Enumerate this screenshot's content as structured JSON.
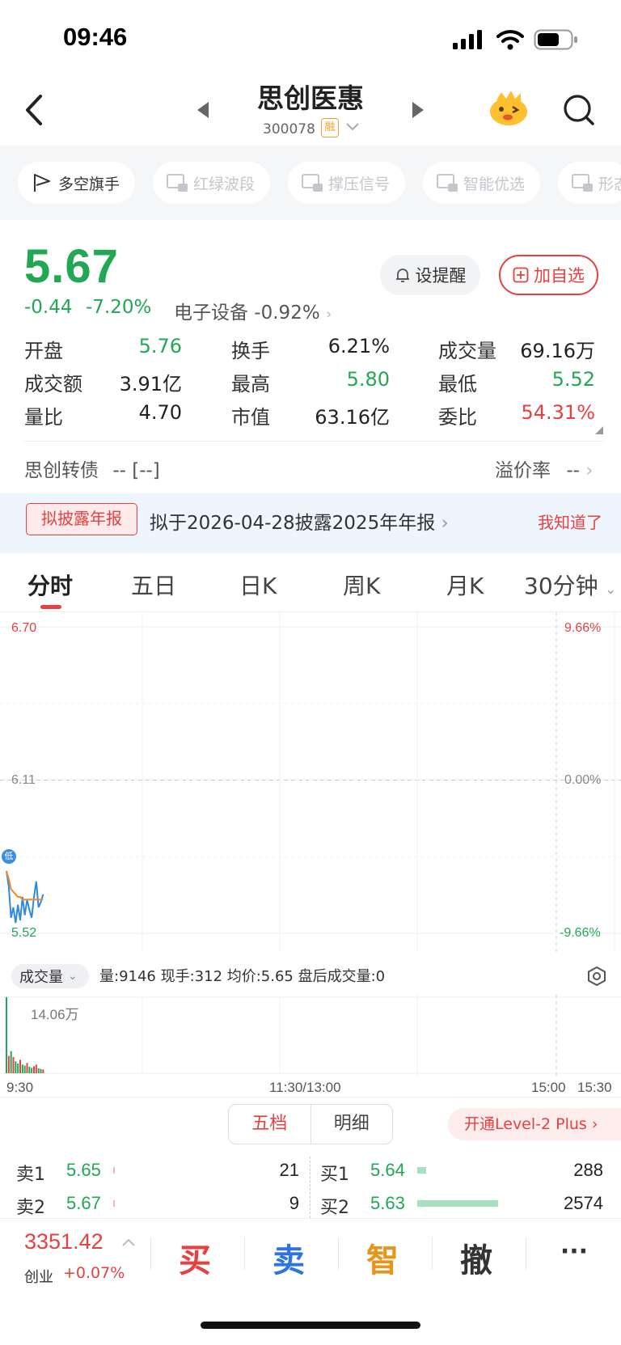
{
  "status_bar": {
    "time": "09:46"
  },
  "header": {
    "title": "思创医惠",
    "code": "300078",
    "rong_badge": "融"
  },
  "tools": [
    {
      "label": "多空旗手",
      "locked": false
    },
    {
      "label": "红绿波段",
      "locked": true
    },
    {
      "label": "撑压信号",
      "locked": true
    },
    {
      "label": "智能优选",
      "locked": true
    },
    {
      "label": "形态",
      "locked": true
    }
  ],
  "quote": {
    "price": "5.67",
    "change": "-0.44",
    "change_pct": "-7.20%",
    "sector": "电子设备 -0.92%",
    "alert_button": "设提醒",
    "watch_button": "加自选",
    "stats": [
      {
        "label": "开盘",
        "value": "5.76",
        "color": "#22a854"
      },
      {
        "label": "换手",
        "value": "6.21%",
        "color": "#222222"
      },
      {
        "label": "成交量",
        "value": "69.16万",
        "color": "#222222"
      },
      {
        "label": "成交额",
        "value": "3.91亿",
        "color": "#222222"
      },
      {
        "label": "最高",
        "value": "5.80",
        "color": "#22a854"
      },
      {
        "label": "最低",
        "value": "5.52",
        "color": "#22a854"
      },
      {
        "label": "量比",
        "value": "4.70",
        "color": "#222222"
      },
      {
        "label": "市值",
        "value": "63.16亿",
        "color": "#222222"
      },
      {
        "label": "委比",
        "value": "54.31%",
        "color": "#e84040"
      }
    ],
    "bond_label": "思创转债",
    "bond_value": "-- [--]",
    "premium_label": "溢价率",
    "premium_value": "--"
  },
  "notice": {
    "tag": "拟披露年报",
    "text": "拟于2026-04-28披露2025年年报",
    "dismiss": "我知道了"
  },
  "chart_tabs": [
    "分时",
    "五日",
    "日K",
    "周K",
    "月K",
    "30分钟"
  ],
  "intraday": {
    "price_high": "6.70",
    "price_mid": "6.11",
    "price_low": "5.52",
    "pct_high": "9.66%",
    "pct_mid": "0.00%",
    "pct_low": "-9.66%",
    "marker": "低"
  },
  "chart_data": {
    "type": "line",
    "title": "",
    "xlabel": "",
    "ylabel": "",
    "ylim": [
      5.52,
      6.7
    ],
    "x_ticks": [
      "9:30",
      "11:30/13:00",
      "15:00",
      "15:30"
    ],
    "series": [
      {
        "values": [
          5.76,
          5.7,
          5.58,
          5.62,
          5.56,
          5.63,
          5.57,
          5.66,
          5.59,
          5.65,
          5.61,
          5.58,
          5.66,
          5.72,
          5.62,
          5.64,
          5.67
        ]
      },
      {
        "values": [
          5.76,
          5.73,
          5.69,
          5.68,
          5.67,
          5.66,
          5.66,
          5.65,
          5.65,
          5.65,
          5.65,
          5.65,
          5.65,
          5.65,
          5.65,
          5.65,
          5.65
        ]
      }
    ],
    "volume_ylim": [
      0,
      14.06
    ],
    "volume": [
      14.06,
      3.2,
      4.1,
      3.0,
      2.2,
      1.8,
      2.5,
      1.6,
      1.4,
      1.9,
      1.2,
      1.0,
      1.3,
      1.6,
      0.9,
      0.8,
      0.7
    ],
    "volume_colors": [
      "#22a854",
      "#e84040",
      "#22a854",
      "#e84040",
      "#22a854",
      "#22a854",
      "#e84040",
      "#22a854",
      "#22a854",
      "#e84040",
      "#22a854",
      "#22a854",
      "#e84040",
      "#e84040",
      "#22a854",
      "#22a854",
      "#e84040"
    ]
  },
  "volume": {
    "selector": "成交量",
    "info": "量:9146  现手:312  均价:5.65  盘后成交量:0",
    "max": "14.06万"
  },
  "order_book": {
    "tab_five": "五档",
    "tab_detail": "明细",
    "level2": "开通Level-2 Plus",
    "asks": [
      {
        "label": "卖1",
        "price": "5.65",
        "volume": "21",
        "level": 0.01
      },
      {
        "label": "卖2",
        "price": "5.67",
        "volume": "9",
        "level": 0.005
      }
    ],
    "bids": [
      {
        "label": "买1",
        "price": "5.64",
        "volume": "288",
        "level": 0.11
      },
      {
        "label": "买2",
        "price": "5.63",
        "volume": "2574",
        "level": 1.0
      }
    ]
  },
  "bottom": {
    "index_value": "3351.42",
    "index_name": "创业",
    "index_change": "+0.07%",
    "actions": [
      "买",
      "卖",
      "智",
      "撤",
      "···"
    ]
  }
}
